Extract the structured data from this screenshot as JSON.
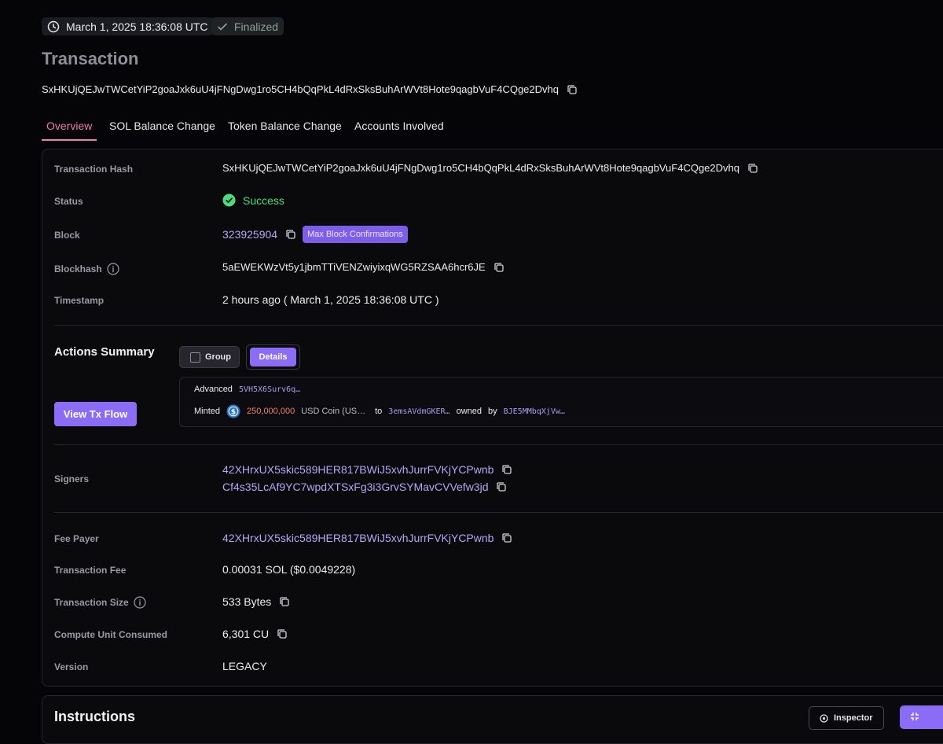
{
  "header": {
    "timestamp": "March 1, 2025 18:36:08 UTC",
    "status_badge": "Finalized",
    "title": "Transaction",
    "signature": "SxHKUjQEJwTWCetYiP2goaJxk6uU4jFNgDwg1ro5CH4bQqPkL4dRxSksBuhArWVt8Hote9qagbVuF4CQge2Dvhq"
  },
  "tabs": [
    {
      "label": "Overview",
      "active": true
    },
    {
      "label": "SOL Balance Change",
      "active": false
    },
    {
      "label": "Token Balance Change",
      "active": false
    },
    {
      "label": "Accounts Involved",
      "active": false
    }
  ],
  "overview": {
    "hash_label": "Transaction Hash",
    "hash_value": "SxHKUjQEJwTWCetYiP2goaJxk6uU4jFNgDwg1ro5CH4bQqPkL4dRxSksBuhArWVt8Hote9qagbVuF4CQge2Dvhq",
    "status_label": "Status",
    "status_value": "Success",
    "block_label": "Block",
    "block_value": "323925904",
    "block_badge": "Max Block Confirmations",
    "blockhash_label": "Blockhash",
    "blockhash_value": "5aEWEKWzVt5y1jbmTTiVENZwiyixqWG5RZSAA6hcr6JE",
    "timestamp_label": "Timestamp",
    "timestamp_value": "2 hours ago ( March 1, 2025 18:36:08 UTC )"
  },
  "actions": {
    "title": "Actions Summary",
    "group_label": "Group",
    "details_label": "Details",
    "view_flow_label": "View Tx Flow",
    "advanced_label": "Advanced",
    "advanced_addr": "5VH5X6Surv6q…",
    "minted_label": "Minted",
    "amount": "250,000,000",
    "token": "USD Coin (US…",
    "to_label": "to",
    "to_addr": "3emsAVdmGKER…",
    "owned_label": "owned",
    "by_label": "by",
    "owner_addr": "BJE5MMbqXjVw…"
  },
  "signers": {
    "label": "Signers",
    "list": [
      "42XHrxUX5skic589HER817BWiJ5xvhJurrFVKjYCPwnb",
      "Cf4s35LcAf9YC7wpdXTSxFg3i3GrvSYMavCVVefw3jd"
    ]
  },
  "fees": {
    "fee_payer_label": "Fee Payer",
    "fee_payer_value": "42XHrxUX5skic589HER817BWiJ5xvhJurrFVKjYCPwnb",
    "fee_label": "Transaction Fee",
    "fee_value": "0.00031 SOL ($0.0049228)",
    "size_label": "Transaction Size",
    "size_value": "533 Bytes",
    "cu_label": "Compute Unit Consumed",
    "cu_value": "6,301 CU",
    "version_label": "Version",
    "version_value": "LEGACY"
  },
  "instructions": {
    "title": "Instructions",
    "inspector_label": "Inspector"
  },
  "colors": {
    "accent": "#8b6cf6",
    "link": "#b6a6f7",
    "success": "#4ade80",
    "tab_active": "#f27aa6"
  }
}
